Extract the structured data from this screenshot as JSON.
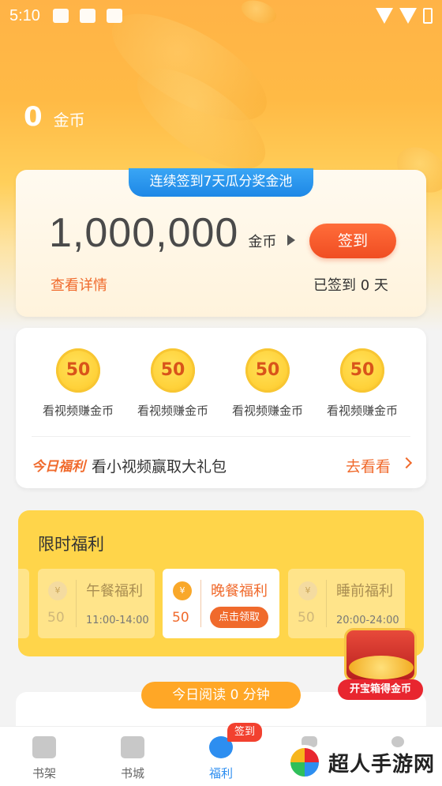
{
  "status_bar": {
    "time": "5:10"
  },
  "coins": {
    "balance": "0",
    "unit": "金币"
  },
  "sign_in": {
    "banner": "连续签到7天瓜分奖金池",
    "pool_amount": "1,000,000",
    "pool_unit": "金币",
    "button": "签到",
    "detail_link": "查看详情",
    "signed_days": "已签到 0 天"
  },
  "video_rewards": {
    "items": [
      {
        "value": "50",
        "label": "看视频赚金币"
      },
      {
        "value": "50",
        "label": "看视频赚金币"
      },
      {
        "value": "50",
        "label": "看视频赚金币"
      },
      {
        "value": "50",
        "label": "看视频赚金币"
      }
    ],
    "today_tag": "今日福利",
    "today_desc": "看小视频赢取大礼包",
    "go_link": "去看看"
  },
  "limited": {
    "title": "限时福利",
    "slots": [
      {
        "name": "午餐福利",
        "amount": "50",
        "time": "11:00-14:00",
        "coin": "¥"
      },
      {
        "name": "晚餐福利",
        "amount": "50",
        "action": "点击领取",
        "coin": "¥"
      },
      {
        "name": "睡前福利",
        "amount": "50",
        "time": "20:00-24:00",
        "coin": "¥"
      }
    ]
  },
  "chest": {
    "label": "开宝箱得金币"
  },
  "reading": {
    "pill": "今日阅读 0 分钟"
  },
  "tabbar": {
    "tabs": [
      {
        "label": "书架",
        "icon": "bookshelf-icon"
      },
      {
        "label": "书城",
        "icon": "book-open-icon"
      },
      {
        "label": "福利",
        "icon": "welfare-icon"
      }
    ],
    "badge": "签到"
  },
  "watermark": {
    "text": "超人手游网"
  },
  "colors": {
    "accent": "#f06a2c",
    "blue": "#2d8ef0",
    "gold": "#ffd54a"
  }
}
